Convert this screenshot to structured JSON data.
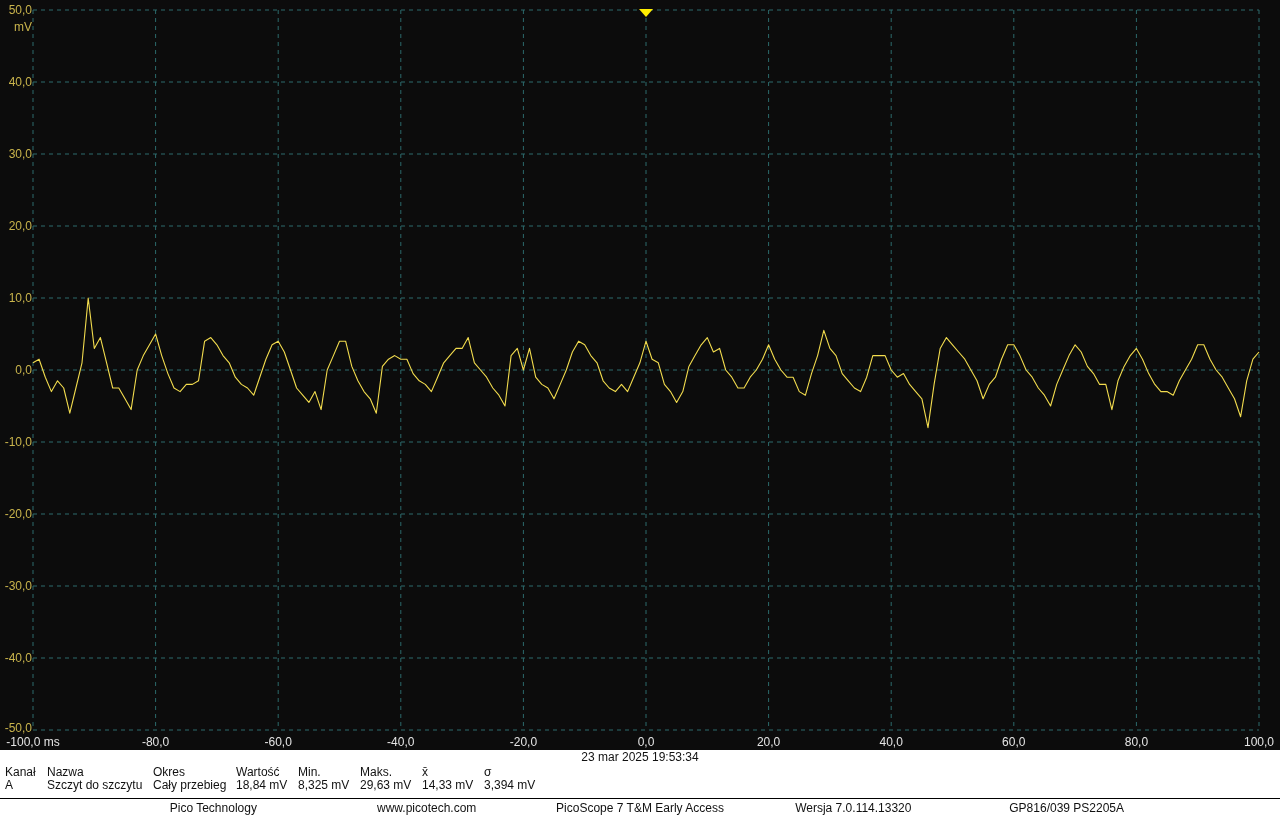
{
  "plot": {
    "chart_data": {
      "type": "line",
      "ylabel": "mV",
      "grid": true,
      "xlim": [
        -100,
        100
      ],
      "ylim": [
        -50,
        50
      ],
      "xticks": [
        {
          "value": -100,
          "label": "-100,0 ms"
        },
        {
          "value": -80,
          "label": "-80,0"
        },
        {
          "value": -60,
          "label": "-60,0"
        },
        {
          "value": -40,
          "label": "-40,0"
        },
        {
          "value": -20,
          "label": "-20,0"
        },
        {
          "value": 0,
          "label": "0,0"
        },
        {
          "value": 20,
          "label": "20,0"
        },
        {
          "value": 40,
          "label": "40,0"
        },
        {
          "value": 60,
          "label": "60,0"
        },
        {
          "value": 80,
          "label": "80,0"
        },
        {
          "value": 100,
          "label": "100,0"
        }
      ],
      "yticks": [
        {
          "value": 50,
          "label": "50,0"
        },
        {
          "value": 40,
          "label": "40,0"
        },
        {
          "value": 30,
          "label": "30,0"
        },
        {
          "value": 20,
          "label": "20,0"
        },
        {
          "value": 10,
          "label": "10,0"
        },
        {
          "value": 0,
          "label": "0,0"
        },
        {
          "value": -10,
          "label": "-10,0"
        },
        {
          "value": -20,
          "label": "-20,0"
        },
        {
          "value": -30,
          "label": "-30,0"
        },
        {
          "value": -40,
          "label": "-40,0"
        },
        {
          "value": -50,
          "label": "-50,0"
        }
      ],
      "x": [
        -100,
        -99,
        -98,
        -97,
        -96,
        -95,
        -94,
        -93,
        -92,
        -91,
        -90,
        -89,
        -88,
        -87,
        -86,
        -85,
        -84,
        -83,
        -82,
        -81,
        -80,
        -79,
        -78,
        -77,
        -76,
        -75,
        -74,
        -73,
        -72,
        -71,
        -70,
        -69,
        -68,
        -67,
        -66,
        -65,
        -64,
        -63,
        -62,
        -61,
        -60,
        -59,
        -58,
        -57,
        -56,
        -55,
        -54,
        -53,
        -52,
        -51,
        -50,
        -49,
        -48,
        -47,
        -46,
        -45,
        -44,
        -43,
        -42,
        -41,
        -40,
        -39,
        -38,
        -37,
        -36,
        -35,
        -34,
        -33,
        -32,
        -31,
        -30,
        -29,
        -28,
        -27,
        -26,
        -25,
        -24,
        -23,
        -22,
        -21,
        -20,
        -19,
        -18,
        -17,
        -16,
        -15,
        -14,
        -13,
        -12,
        -11,
        -10,
        -9,
        -8,
        -7,
        -6,
        -5,
        -4,
        -3,
        -2,
        -1,
        0,
        1,
        2,
        3,
        4,
        5,
        6,
        7,
        8,
        9,
        10,
        11,
        12,
        13,
        14,
        15,
        16,
        17,
        18,
        19,
        20,
        21,
        22,
        23,
        24,
        25,
        26,
        27,
        28,
        29,
        30,
        31,
        32,
        33,
        34,
        35,
        36,
        37,
        38,
        39,
        40,
        41,
        42,
        43,
        44,
        45,
        46,
        47,
        48,
        49,
        50,
        51,
        52,
        53,
        54,
        55,
        56,
        57,
        58,
        59,
        60,
        61,
        62,
        63,
        64,
        65,
        66,
        67,
        68,
        69,
        70,
        71,
        72,
        73,
        74,
        75,
        76,
        77,
        78,
        79,
        80,
        81,
        82,
        83,
        84,
        85,
        86,
        87,
        88,
        89,
        90,
        91,
        92,
        93,
        94,
        95,
        96,
        97,
        98,
        99,
        100
      ],
      "series": [
        {
          "color": "#f2dc4e",
          "values": [
            1,
            1.5,
            -1,
            -3,
            -1.5,
            -2.5,
            -6,
            -2.5,
            1,
            10,
            3,
            4.5,
            1,
            -2.5,
            -2.5,
            -4,
            -5.5,
            0,
            2,
            3.5,
            5,
            2,
            -0.5,
            -2.5,
            -3,
            -2,
            -2,
            -1.5,
            4,
            4.5,
            3.5,
            2,
            1,
            -1,
            -2,
            -2.5,
            -3.5,
            -1,
            1.5,
            3.5,
            4,
            2.5,
            0,
            -2.5,
            -3.5,
            -4.5,
            -3,
            -5.5,
            0,
            2,
            4,
            4,
            0.5,
            -1.5,
            -3,
            -4,
            -6,
            0.5,
            1.5,
            2,
            1.5,
            1.5,
            -0.5,
            -1.5,
            -2,
            -3,
            -1,
            1,
            2,
            3,
            3,
            4.5,
            1,
            0,
            -1,
            -2.5,
            -3.5,
            -5,
            2,
            3,
            0,
            3,
            -1,
            -2,
            -2.5,
            -4,
            -2,
            0,
            2.5,
            4,
            3.5,
            2,
            1,
            -1.5,
            -2.5,
            -3,
            -2,
            -3,
            -1,
            1,
            4,
            1.5,
            1,
            -2,
            -3,
            -4.5,
            -3,
            0.5,
            2,
            3.5,
            4.5,
            2.5,
            3,
            0,
            -1,
            -2.5,
            -2.5,
            -1,
            0,
            1.5,
            3.5,
            1.5,
            0,
            -1,
            -1,
            -3,
            -3.5,
            -0.5,
            2,
            5.5,
            3,
            2,
            -0.5,
            -1.5,
            -2.5,
            -3,
            -1,
            2,
            2,
            2,
            0,
            -1,
            -0.5,
            -2,
            -3,
            -4,
            -8,
            -2,
            3,
            4.5,
            3.5,
            2.5,
            1.5,
            0,
            -1.5,
            -4,
            -2,
            -1,
            1.5,
            3.5,
            3.5,
            2,
            0,
            -1,
            -2.5,
            -3.5,
            -5,
            -2,
            0,
            2,
            3.5,
            2.5,
            0.5,
            -0.5,
            -2,
            -2,
            -5.5,
            -1.5,
            0.5,
            2,
            3,
            1.5,
            -0.5,
            -2,
            -3,
            -3,
            -3.5,
            -1.5,
            0,
            1.5,
            3.5,
            3.5,
            1.5,
            0,
            -1,
            -2.5,
            -4,
            -6.5,
            -1.5,
            1.5,
            2.5
          ]
        }
      ]
    }
  },
  "capture_time": "23 mar 2025 19:53:34",
  "measurements": {
    "columns": [
      "Kanał",
      "Nazwa",
      "Okres",
      "Wartość",
      "Min.",
      "Maks.",
      "x̄",
      "σ"
    ],
    "rows": [
      [
        "A",
        "Szczyt do szczytu",
        "Cały przebieg",
        "18,84 mV",
        "8,325 mV",
        "29,63 mV",
        "14,33 mV",
        "3,394 mV"
      ]
    ]
  },
  "footer": [
    "Pico Technology",
    "www.picotech.com",
    "PicoScope 7 T&M Early Access",
    "Wersja 7.0.114.13320",
    "GP816/039 PS2205A"
  ]
}
